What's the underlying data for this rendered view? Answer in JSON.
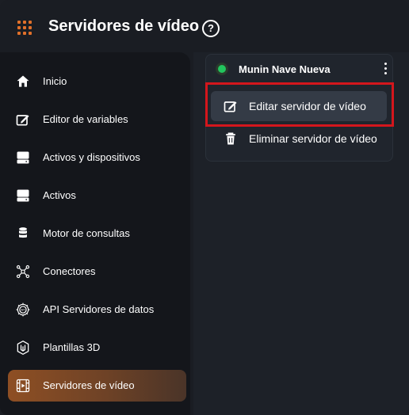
{
  "header": {
    "title": "Servidores de vídeo",
    "help_symbol": "?",
    "accent_color": "#e0702a"
  },
  "sidebar": {
    "items": [
      {
        "label": "Inicio",
        "icon": "home-icon"
      },
      {
        "label": "Editor de variables",
        "icon": "edit-icon"
      },
      {
        "label": "Activos y dispositivos",
        "icon": "drive-icon"
      },
      {
        "label": "Activos",
        "icon": "drive-icon"
      },
      {
        "label": "Motor de consultas",
        "icon": "database-icon"
      },
      {
        "label": "Conectores",
        "icon": "connectors-icon"
      },
      {
        "label": "API Servidores de datos",
        "icon": "api-icon"
      },
      {
        "label": "Plantillas 3D",
        "icon": "template-3d-icon"
      },
      {
        "label": "Servidores de vídeo",
        "icon": "video-server-icon",
        "active": true
      }
    ]
  },
  "server_card": {
    "name": "Munin Nave Nueva",
    "status": "online",
    "status_color": "#22c55e",
    "menu": {
      "edit_label": "Editar servidor de vídeo",
      "delete_label": "Eliminar servidor de vídeo"
    }
  },
  "annotation": {
    "highlight_color": "#d4161c"
  }
}
